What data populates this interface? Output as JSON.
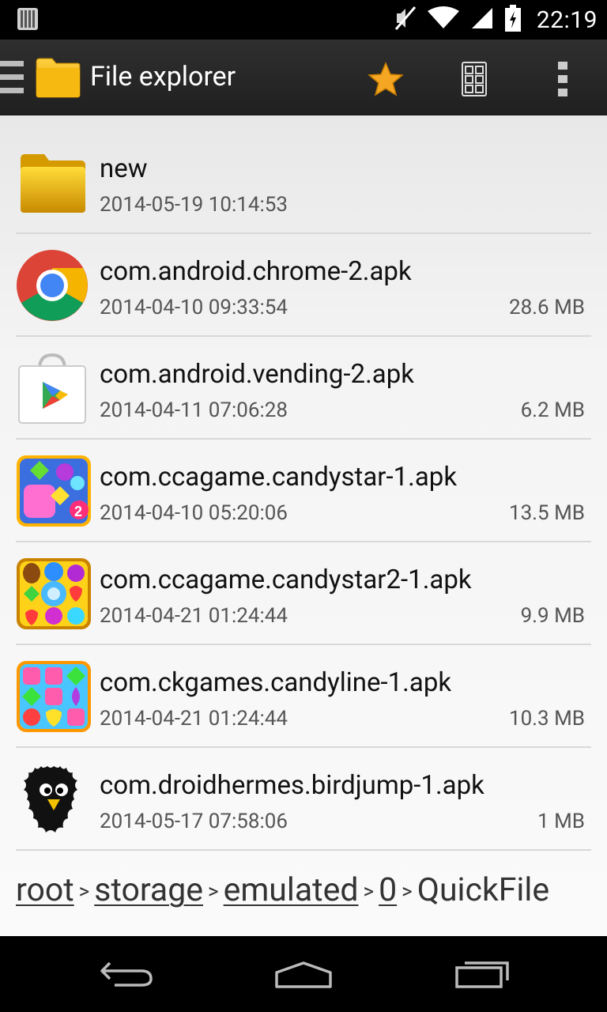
{
  "status_bar": {
    "time": "22:19",
    "icons": [
      "notification-icon",
      "mute-icon",
      "wifi-icon",
      "signal-icon",
      "battery-icon"
    ]
  },
  "action_bar": {
    "title": "File explorer",
    "icons": [
      "hamburger-icon",
      "folder-icon",
      "star-icon",
      "grid-view-icon",
      "overflow-menu-icon"
    ],
    "star_color": "#F5A623"
  },
  "files": [
    {
      "name": "new",
      "date": "2014-05-19 10:14:53",
      "size": "",
      "icon": "folder-icon"
    },
    {
      "name": "com.android.chrome-2.apk",
      "date": "2014-04-10 09:33:54",
      "size": "28.6 MB",
      "icon": "chrome-icon"
    },
    {
      "name": "com.android.vending-2.apk",
      "date": "2014-04-11 07:06:28",
      "size": "6.2 MB",
      "icon": "play-store-icon"
    },
    {
      "name": "com.ccagame.candystar-1.apk",
      "date": "2014-04-10 05:20:06",
      "size": "13.5 MB",
      "icon": "candystar-icon"
    },
    {
      "name": "com.ccagame.candystar2-1.apk",
      "date": "2014-04-21 01:24:44",
      "size": "9.9 MB",
      "icon": "candystar2-icon"
    },
    {
      "name": "com.ckgames.candyline-1.apk",
      "date": "2014-04-21 01:24:44",
      "size": "10.3 MB",
      "icon": "candyline-icon"
    },
    {
      "name": "com.droidhermes.birdjump-1.apk",
      "date": "2014-05-17 07:58:06",
      "size": "1 MB",
      "icon": "bird-icon"
    }
  ],
  "breadcrumb": [
    "root",
    "storage",
    "emulated",
    "0",
    "QuickFile"
  ],
  "nav_bar": {
    "icons": [
      "back-icon",
      "home-icon",
      "recents-icon"
    ]
  }
}
